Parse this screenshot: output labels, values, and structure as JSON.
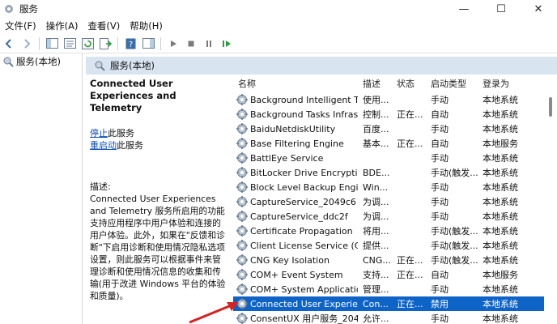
{
  "window": {
    "title": "服务",
    "controls": {
      "minimize": "—",
      "maximize": "☐",
      "close": "✕"
    }
  },
  "menu": [
    "文件(F)",
    "操作(A)",
    "查看(V)",
    "帮助(H)"
  ],
  "tree": {
    "root": "服务(本地)"
  },
  "pane": {
    "header": "服务(本地)"
  },
  "description": {
    "service_name": "Connected User Experiences and Telemetry",
    "stop_link": "停止",
    "stop_suffix": "此服务",
    "restart_link": "重启动",
    "restart_suffix": "此服务",
    "label": "描述:",
    "text": "Connected User Experiences and Telemetry 服务所启用的功能支持应用程序中用户体验和连接的用户体验。此外，如果在\"反馈和诊断\"下启用诊断和使用情况隐私选项设置，则此服务可以根据事件来管理诊断和使用情况信息的收集和传输(用于改进 Windows 平台的体验和质量)。"
  },
  "table": {
    "headers": {
      "name": "名称",
      "desc": "描述",
      "status": "状态",
      "start": "启动类型",
      "logon": "登录为"
    },
    "rows": [
      {
        "name": "Background Intelligent Tra...",
        "desc": "使用...",
        "status": "",
        "start": "手动",
        "logon": "本地系统"
      },
      {
        "name": "Background Tasks Infrastru...",
        "desc": "控制...",
        "status": "正在...",
        "start": "自动",
        "logon": "本地系统"
      },
      {
        "name": "BaiduNetdiskUtility",
        "desc": "百度...",
        "status": "",
        "start": "手动",
        "logon": "本地系统"
      },
      {
        "name": "Base Filtering Engine",
        "desc": "基本...",
        "status": "正在...",
        "start": "自动",
        "logon": "本地服务"
      },
      {
        "name": "BattlEye Service",
        "desc": "",
        "status": "",
        "start": "手动",
        "logon": "本地系统"
      },
      {
        "name": "BitLocker Drive Encryption ...",
        "desc": "BDE...",
        "status": "",
        "start": "手动(触发...",
        "logon": "本地系统"
      },
      {
        "name": "Block Level Backup Engine ...",
        "desc": "Win...",
        "status": "",
        "start": "手动",
        "logon": "本地系统"
      },
      {
        "name": "CaptureService_2049c6",
        "desc": "为调...",
        "status": "",
        "start": "手动",
        "logon": "本地系统"
      },
      {
        "name": "CaptureService_ddc2f",
        "desc": "为调...",
        "status": "",
        "start": "手动",
        "logon": "本地系统"
      },
      {
        "name": "Certificate Propagation",
        "desc": "将用...",
        "status": "",
        "start": "手动(触发...",
        "logon": "本地系统"
      },
      {
        "name": "Client License Service (Clip...",
        "desc": "提供...",
        "status": "",
        "start": "手动(触发...",
        "logon": "本地系统"
      },
      {
        "name": "CNG Key Isolation",
        "desc": "CNG...",
        "status": "正在...",
        "start": "手动(触发...",
        "logon": "本地系统"
      },
      {
        "name": "COM+ Event System",
        "desc": "支持...",
        "status": "正在...",
        "start": "自动",
        "logon": "本地服务"
      },
      {
        "name": "COM+ System Application",
        "desc": "管理...",
        "status": "",
        "start": "手动",
        "logon": "本地系统"
      },
      {
        "name": "Connected User Experienc...",
        "desc": "Con...",
        "status": "正在...",
        "start": "禁用",
        "logon": "本地系统"
      },
      {
        "name": "ConsentUX 用户服务_2049...",
        "desc": "允许...",
        "status": "",
        "start": "手动",
        "logon": "本地系统"
      }
    ],
    "selected_index": 14
  },
  "colors": {
    "selection": "#0e63c7",
    "pane_header": "#d9e4f1",
    "link": "#0a4fb5",
    "arrow": "#d62222"
  }
}
